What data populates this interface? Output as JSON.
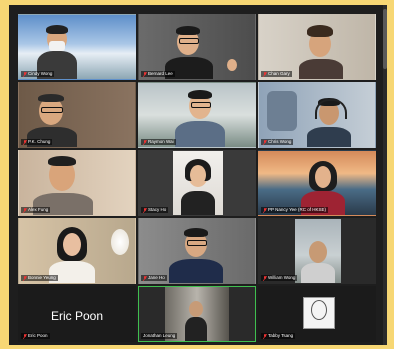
{
  "meeting": {
    "tiles": [
      {
        "name": "Cindy Wong"
      },
      {
        "name": "Bernard Lee"
      },
      {
        "name": "Chan Gary"
      },
      {
        "name": "P.K. Chung"
      },
      {
        "name": "Raymon Wai"
      },
      {
        "name": "Chris Wong"
      },
      {
        "name": "Alex Fung"
      },
      {
        "name": "Stacy Ho"
      },
      {
        "name": "PP Nancy Yee (RC of HKSE)"
      },
      {
        "name": "Bonnie Yeung"
      },
      {
        "name": "Jane Ho"
      },
      {
        "name": "William Wong"
      },
      {
        "name": "Eric Poon",
        "display_name": "Eric Poon"
      },
      {
        "name": "Jonathan Leung"
      },
      {
        "name": "Tabby Tsang"
      }
    ],
    "active_speaker_index": 13
  }
}
